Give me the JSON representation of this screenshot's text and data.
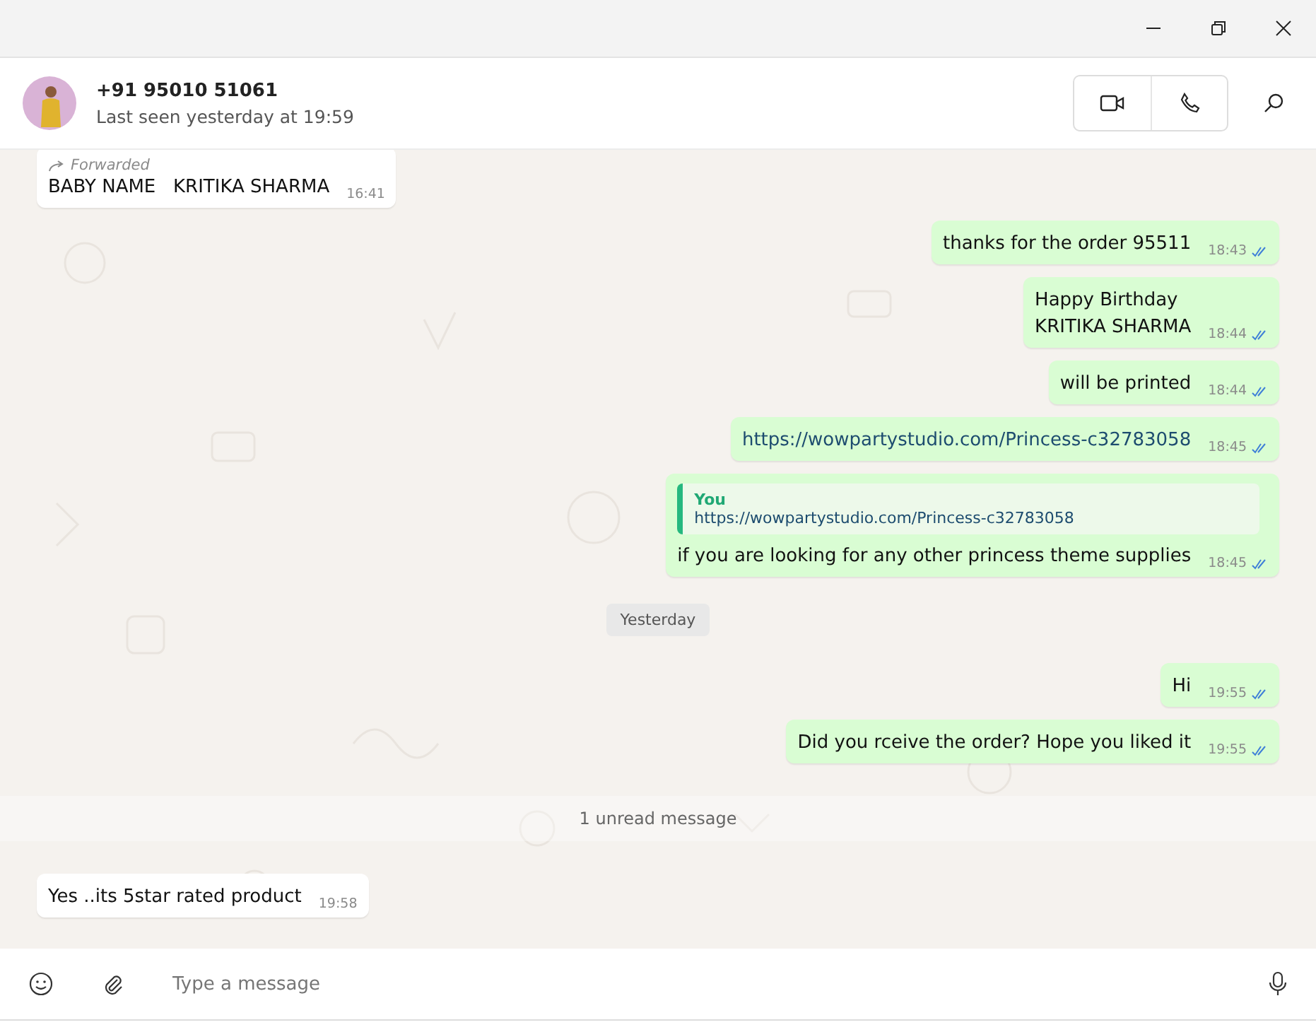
{
  "contact": {
    "name": "+91 95010 51061",
    "status": "Last seen yesterday at 19:59"
  },
  "messages": [
    {
      "kind": "in",
      "forwarded": "Forwarded",
      "text": "BABY NAME   KRITIKA SHARMA",
      "time": "16:41"
    },
    {
      "kind": "out",
      "text": "thanks for the order 95511",
      "time": "18:43",
      "read": true
    },
    {
      "kind": "out",
      "text": "Happy Birthday\nKRITIKA SHARMA",
      "time": "18:44",
      "read": true
    },
    {
      "kind": "out",
      "text": "will be printed",
      "time": "18:44",
      "read": true
    },
    {
      "kind": "out",
      "link": "https://wowpartystudio.com/Princess-c32783058",
      "time": "18:45",
      "read": true
    },
    {
      "kind": "out",
      "quote": {
        "author": "You",
        "text": "https://wowpartystudio.com/Princess-c32783058"
      },
      "text": "if you are looking for any other princess theme supplies",
      "time": "18:45",
      "read": true
    },
    {
      "kind": "date",
      "text": "Yesterday"
    },
    {
      "kind": "out",
      "text": "Hi",
      "time": "19:55",
      "read": true
    },
    {
      "kind": "out",
      "text": "Did you rceive the order? Hope you liked it",
      "time": "19:55",
      "read": true
    },
    {
      "kind": "unread",
      "text": "1 unread message"
    },
    {
      "kind": "in",
      "text": "Yes ..its 5star rated product",
      "time": "19:58"
    }
  ],
  "composer": {
    "placeholder": "Type a message"
  }
}
